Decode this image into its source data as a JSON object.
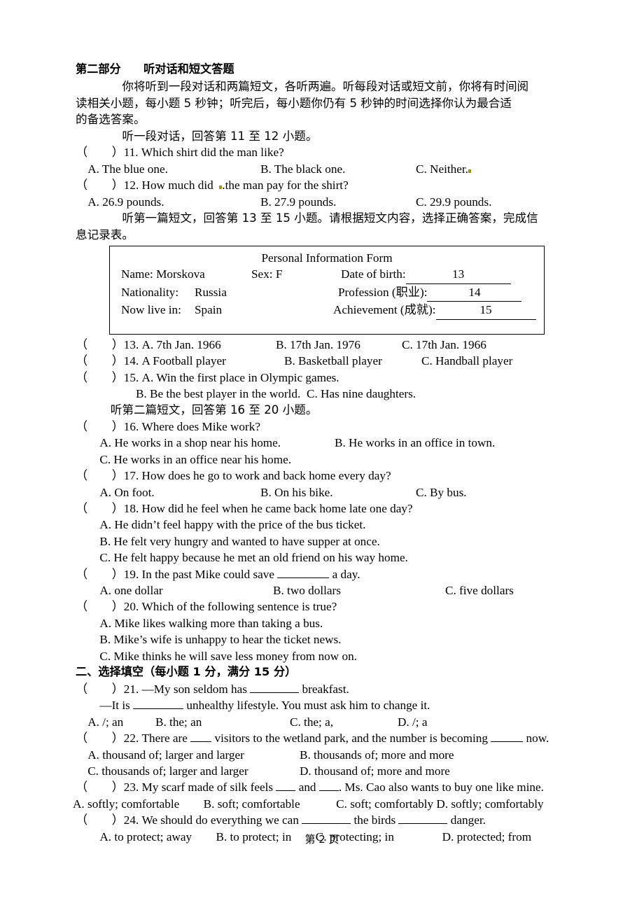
{
  "document": {
    "section_heading": "第二部分　　听对话和短文答题",
    "intro_l1": "　　　　你将听到一段对话和两篇短文，各听两遍。听每段对话或短文前，你将有时间阅",
    "intro_l2": "读相关小题，每小题 5 秒钟；听完后，每小题你仍有 5 秒钟的时间选择你认为最合适",
    "intro_l3": "的备选答案。",
    "dialogue_prompt": "　　　　听一段对话，回答第 11 至 12 小题。",
    "passage1_prompt_l1": "　　　　听第一篇短文，回答第 13 至 15 小题。请根据短文内容，选择正确答案，完成信",
    "passage1_prompt_l2": "息记录表。",
    "passage2_prompt": "　　　听第二篇短文，回答第 16 至 20 小题。",
    "part2_heading": "二、选择填空（每小题 1 分，满分 15 分）",
    "footer": "第 2 页"
  },
  "form": {
    "title": "Personal Information Form",
    "row1": {
      "name_label": "Name: Morskova",
      "sex_label": "Sex: F",
      "dob_label": "Date of birth:",
      "dob_value": "13"
    },
    "row2": {
      "nationality_label": "Nationality:",
      "nationality_value": "Russia",
      "profession_label": "Profession (职业):",
      "profession_value": "14"
    },
    "row3": {
      "live_label": "Now live in:",
      "live_value": "Spain",
      "achievement_label": "Achievement (成就):",
      "achievement_value": "15"
    }
  },
  "questions": {
    "q11": {
      "stem": "（　　）11. Which shirt did the man like?",
      "a": "　A. The blue one.",
      "b": "B. The black one.",
      "c": "C. Neither."
    },
    "q12": {
      "stem_pre": "（　　）12. How much did  ",
      "stem_post": ".the man pay for the shirt?",
      "a": "　A. 26.9 pounds.",
      "b": "B. 27.9 pounds.",
      "c": "C. 29.9 pounds."
    },
    "q13": {
      "stem": "（　　）13. A. 7th Jan. 1966",
      "b": "B. 17th Jan. 1976",
      "c": "C. 17th Jan. 1966"
    },
    "q14": {
      "stem": "（　　）14. A Football player",
      "b": "B. Basketball player",
      "c": "C. Handball player"
    },
    "q15": {
      "stem": "（　　）15. A. Win the first place in Olympic games.",
      "line2_b": "　　　　　B. Be the best player in the world.",
      "line2_c": "C. Has nine daughters."
    },
    "q16": {
      "stem": "（　　）16. Where does Mike work?",
      "a": "　　A. He works in a shop near his home.",
      "b": "B. He works in an office in town.",
      "c": "　　C. He works in an office near his home."
    },
    "q17": {
      "stem": "（　　）17. How does he go to work and back home every day?",
      "a": "　　A. On foot.",
      "b": "B. On his bike.",
      "c": "C. By bus."
    },
    "q18": {
      "stem": "（　　）18. How did he feel when he came back home late one day?",
      "a": "　　A. He didn’t feel happy with the price of the bus ticket.",
      "b": "　　B. He felt very hungry and wanted to have supper at once.",
      "c": "　　C. He felt happy because he met an old friend on his way home."
    },
    "q19": {
      "stem_pre": "（　　）19. In the past Mike could save ",
      "stem_post": " a day.",
      "a": "　　A. one dollar",
      "b": "B. two dollars",
      "c": "C. five dollars"
    },
    "q20": {
      "stem": "（　　）20. Which of the following sentence is true?",
      "a": "　　A. Mike likes walking more than taking a bus.",
      "b": "　　B. Mike’s wife is unhappy to hear the ticket news.",
      "c": "　　C. Mike thinks he will save less money from now on."
    },
    "q21": {
      "stem_pre": "（　　）21. —My son seldom has ",
      "stem_post": " breakfast.",
      "line2_pre": "　　—It is ",
      "line2_post": " unhealthy lifestyle. You must ask him to change it.",
      "a": "　A. /; an",
      "b": "B. the; an",
      "c": "C. the; a,",
      "d": "D. /; a"
    },
    "q22": {
      "stem_pre": "（　　）22. There are ",
      "stem_mid": " visitors to the wetland park, and the number is becoming ",
      "stem_post": " now.",
      "a": "　A. thousand of; larger and larger",
      "b": "B. thousands of; more and more",
      "c": "　C. thousands of; larger and larger",
      "d": "D. thousand of; more and more"
    },
    "q23": {
      "stem_pre": "（　　）23. My scarf made of silk feels ",
      "stem_mid": " and ",
      "stem_post": ". Ms. Cao also wants to buy one like mine.",
      "options": "A. softly; comfortable　　B. soft; comfortable　　　C. soft; comfortably D. softly; comfortably"
    },
    "q24": {
      "stem_pre": "（　　）24. We should do everything we can ",
      "stem_mid": " the birds ",
      "stem_post": " danger.",
      "options": "　　A. to protect; away　　B. to protect; in　　C. protecting; in　　　　D. protected; from"
    }
  },
  "colors": {
    "text": "#000000",
    "edit_mark": "#9a9a14",
    "page_background": "#ffffff"
  }
}
